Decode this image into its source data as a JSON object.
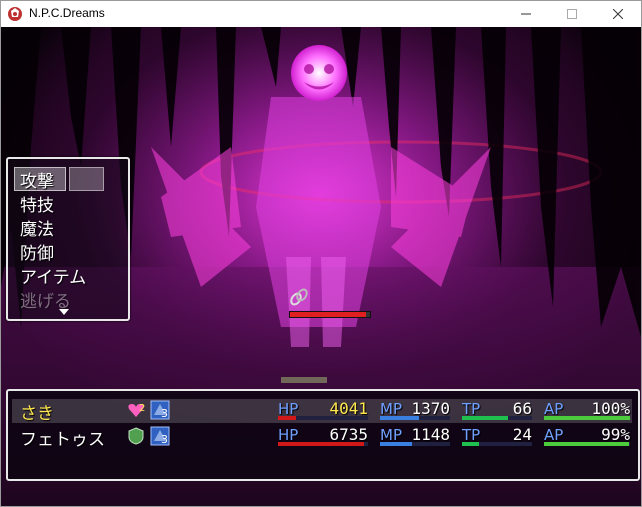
{
  "window": {
    "title": "N.P.C.Dreams"
  },
  "command_menu": {
    "items": [
      "攻撃",
      "特技",
      "魔法",
      "防御",
      "アイテム",
      "逃げる"
    ]
  },
  "party": [
    {
      "name": "さき",
      "name_color": "#ffe94d",
      "state_icons": [
        "heart-2-icon",
        "agi-3-icon"
      ],
      "state_badges": [
        "2",
        "3"
      ],
      "hp_label": "HP",
      "hp": "4041",
      "hp_color": "#ffe94d",
      "hp_ratio": 0.2,
      "mp_label": "MP",
      "mp": "1370",
      "mp_ratio": 0.55,
      "tp_label": "TP",
      "tp": "66",
      "tp_ratio": 0.66,
      "ap_label": "AP",
      "ap": "100%",
      "ap_ratio": 1.0
    },
    {
      "name": "フェトゥス",
      "name_color": "#ffffff",
      "state_icons": [
        "shield-buff-icon",
        "agi-3-icon"
      ],
      "state_badges": [
        "",
        "3"
      ],
      "hp_label": "HP",
      "hp": "6735",
      "hp_color": "#ffffff",
      "hp_ratio": 0.95,
      "mp_label": "MP",
      "mp": "1148",
      "mp_ratio": 0.45,
      "tp_label": "TP",
      "tp": "24",
      "tp_ratio": 0.24,
      "ap_label": "AP",
      "ap": "99%",
      "ap_ratio": 0.99
    }
  ],
  "enemy": {
    "hp_ratio": 0.95,
    "state_icon": "chain-icon"
  },
  "colors": {
    "hp_gauge": "#d01818",
    "mp_gauge": "#3a80e0",
    "tp_gauge": "#20c050",
    "ap_gauge": "#4ccc3c",
    "label": "#70a0ff",
    "boss_glow": "#ff30e0"
  }
}
